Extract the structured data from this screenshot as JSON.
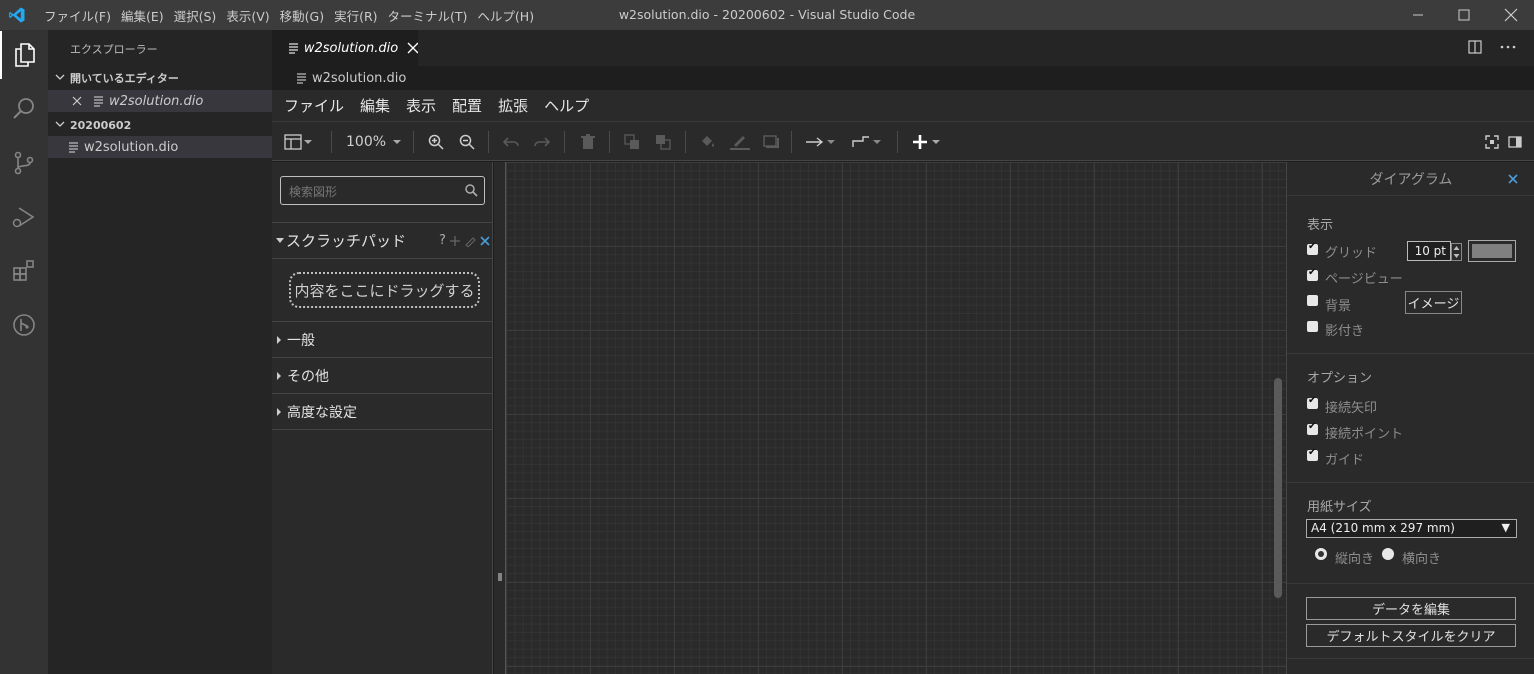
{
  "titlebar": {
    "menus": [
      "ファイル(F)",
      "編集(E)",
      "選択(S)",
      "表示(V)",
      "移動(G)",
      "実行(R)",
      "ターミナル(T)",
      "ヘルプ(H)"
    ],
    "title": "w2solution.dio - 20200602 - Visual Studio Code"
  },
  "explorer": {
    "header": "エクスプローラー",
    "open_editors_label": "開いているエディター",
    "open_editor_file": "w2solution.dio",
    "folder_label": "20200602",
    "folder_file": "w2solution.dio"
  },
  "editor": {
    "tab_label": "w2solution.dio",
    "breadcrumb": "w2solution.dio"
  },
  "drawio": {
    "menus": [
      "ファイル",
      "編集",
      "表示",
      "配置",
      "拡張",
      "ヘルプ"
    ],
    "zoom": "100%",
    "shapes": {
      "search_placeholder": "検索図形",
      "scratchpad_label": "スクラッチパッド",
      "scratchpad_help": "?",
      "dropzone_text": "内容をここにドラッグする",
      "sections": [
        "一般",
        "その他",
        "高度な設定"
      ]
    },
    "format": {
      "title": "ダイアグラム",
      "view_label": "表示",
      "grid_label": "グリッド",
      "grid_size": "10 pt",
      "page_view_label": "ページビュー",
      "background_label": "背景",
      "image_button": "イメージ",
      "shadow_label": "影付き",
      "options_label": "オプション",
      "connection_arrows_label": "接続矢印",
      "connection_points_label": "接続ポイント",
      "guides_label": "ガイド",
      "paper_size_label": "用紙サイズ",
      "paper_size_value": "A4 (210 mm x 297 mm)",
      "portrait_label": "縦向き",
      "landscape_label": "横向き",
      "edit_data_button": "データを編集",
      "clear_style_button": "デフォルトスタイルをクリア",
      "checks": {
        "grid": true,
        "page_view": true,
        "background": false,
        "shadow": false,
        "arrows": true,
        "points": true,
        "guides": true
      },
      "orientation": "portrait"
    }
  },
  "colors": {
    "accent": "#007acc",
    "titlebar": "#3c3c3c",
    "activitybar": "#333333",
    "sidebar": "#252526",
    "editor": "#1e1e1e",
    "drawio_panel": "#2a2a2a"
  }
}
